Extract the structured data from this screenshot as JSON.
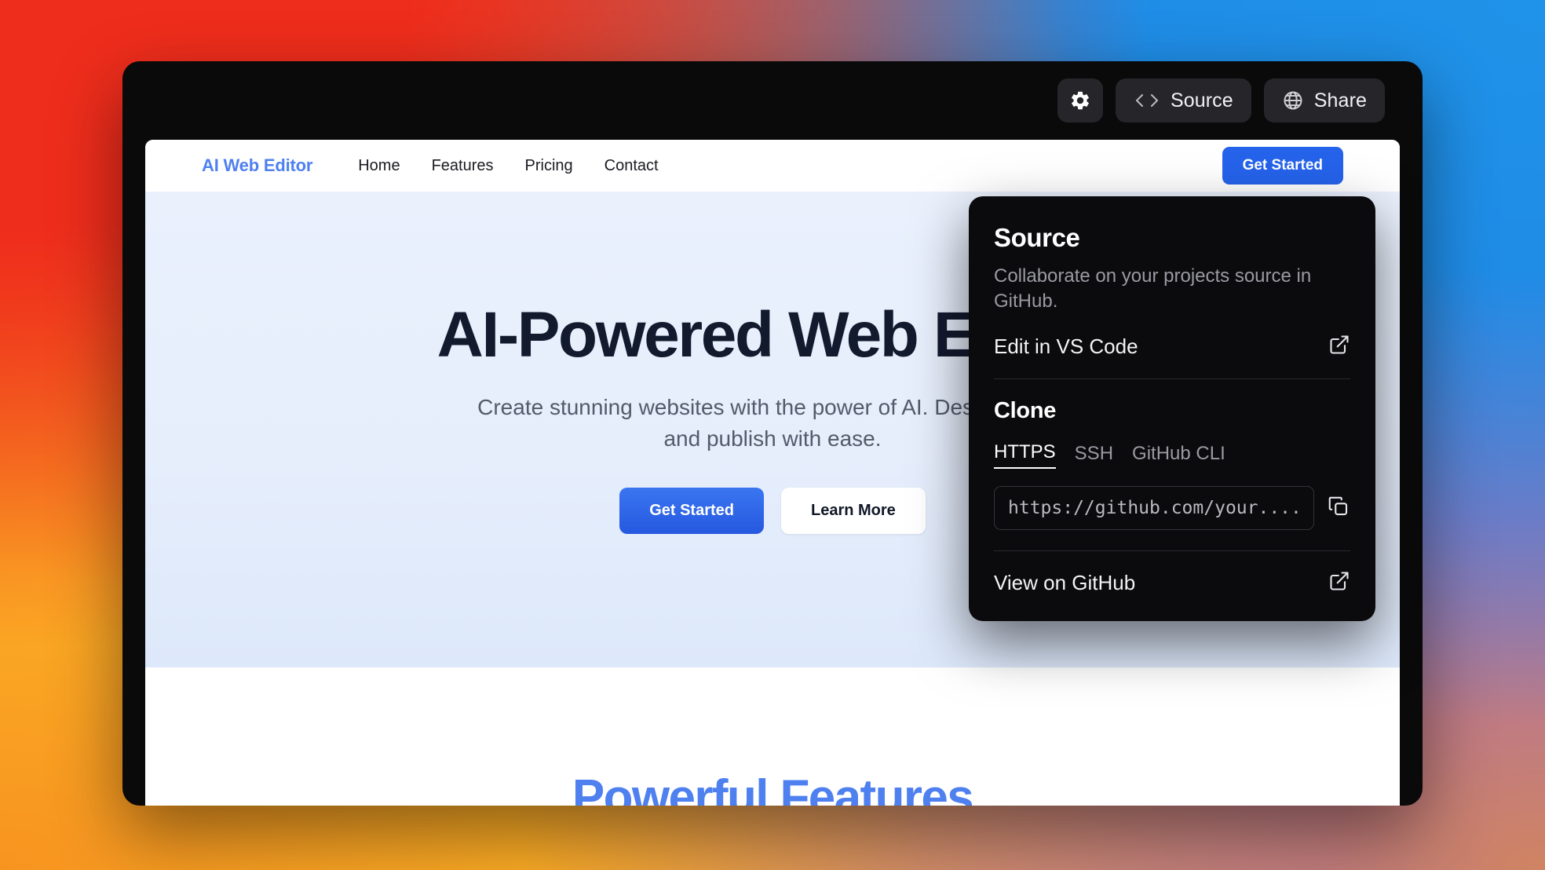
{
  "toolbar": {
    "settings_icon": "gear-icon",
    "source_label": "Source",
    "source_icon": "code-brackets-icon",
    "share_label": "Share",
    "share_icon": "globe-icon"
  },
  "source_panel": {
    "title": "Source",
    "description": "Collaborate on your projects source in GitHub.",
    "edit_vscode_label": "Edit in VS Code",
    "edit_vscode_icon": "external-link-icon",
    "clone_title": "Clone",
    "clone_tabs": [
      {
        "label": "HTTPS",
        "active": true
      },
      {
        "label": "SSH",
        "active": false
      },
      {
        "label": "GitHub CLI",
        "active": false
      }
    ],
    "clone_url_value": "https://github.com/your....",
    "copy_icon": "copy-icon",
    "view_github_label": "View on GitHub",
    "view_github_icon": "external-link-icon"
  },
  "preview": {
    "nav": {
      "brand": "AI Web Editor",
      "links": [
        "Home",
        "Features",
        "Pricing",
        "Contact"
      ],
      "cta_label": "Get Started"
    },
    "hero": {
      "heading": "AI-Powered Web Editor",
      "subtitle": "Create stunning websites with the power of AI. Design, build, and publish with ease.",
      "primary_cta": "Get Started",
      "secondary_cta": "Learn More"
    },
    "features": {
      "heading": "Powerful Features"
    }
  },
  "colors": {
    "accent_blue": "#2563eb",
    "brand_blue": "#4f80f0",
    "panel_bg": "#0b0b0d",
    "window_bg": "#0a0a0b",
    "toolbar_btn": "#26262a",
    "hero_bg": "#e6eefc",
    "bg_top_left": "#ef2d1c",
    "bg_top_right": "#1f93e9",
    "bg_bottom_left": "#fbab24",
    "bg_bottom_right": "#a96fae"
  }
}
